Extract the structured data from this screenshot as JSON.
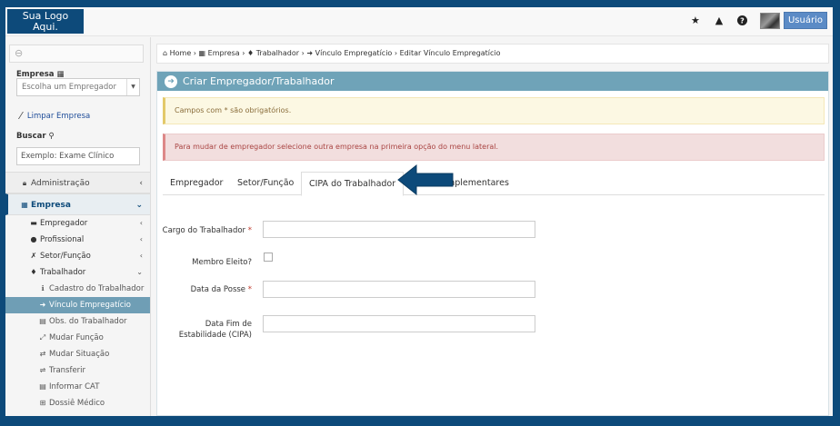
{
  "logo": {
    "line1": "Sua Logo",
    "line2": "Aqui."
  },
  "topbar": {
    "icons": [
      "star-icon",
      "warning-icon",
      "help-icon"
    ],
    "user_label": "Usuário"
  },
  "sidebar": {
    "collapse_symbol": "⊖",
    "empresa_label": "Empresa",
    "empresa_select": "Escolha um Empregador",
    "clear_label": "Limpar Empresa",
    "search_label": "Buscar",
    "search_value": "Exemplo: Exame Clínico",
    "menu": {
      "admin": "Administração",
      "empresa": "Empresa",
      "empregador": "Empregador",
      "profissional": "Profissional",
      "setor_funcao": "Setor/Função",
      "trabalhador": "Trabalhador",
      "cadastro": "Cadastro do Trabalhador",
      "vinculo": "Vínculo Empregatício",
      "obs": "Obs. do Trabalhador",
      "mudar_funcao": "Mudar Função",
      "mudar_situacao": "Mudar Situação",
      "transferir": "Transferir",
      "informar_cat": "Informar CAT",
      "dossie": "Dossiê Médico"
    }
  },
  "breadcrumb": {
    "home": "Home",
    "empresa": "Empresa",
    "trabalhador": "Trabalhador",
    "vinculo": "Vínculo Empregatício",
    "editar": "Editar Vínculo Empregatício"
  },
  "panel": {
    "title": "Criar Empregador/Trabalhador",
    "warning": "Campos com * são obrigatórios.",
    "error": "Para mudar de empregador selecione outra empresa na primeira opção do menu lateral."
  },
  "tabs": [
    "Empregador",
    "Setor/Função",
    "CIPA do Trabalhador",
    "mplementares"
  ],
  "form": {
    "cargo_label": "Cargo do Trabalhador",
    "membro_label": "Membro Eleito?",
    "posse_label": "Data da Posse",
    "fim_label_1": "Data Fim de",
    "fim_label_2": "Estabilidade (CIPA)",
    "required_mark": "*"
  },
  "colors": {
    "brand": "#0d4a7a",
    "panel_head": "#6fa3b8",
    "active_item": "#6f9eb5"
  }
}
